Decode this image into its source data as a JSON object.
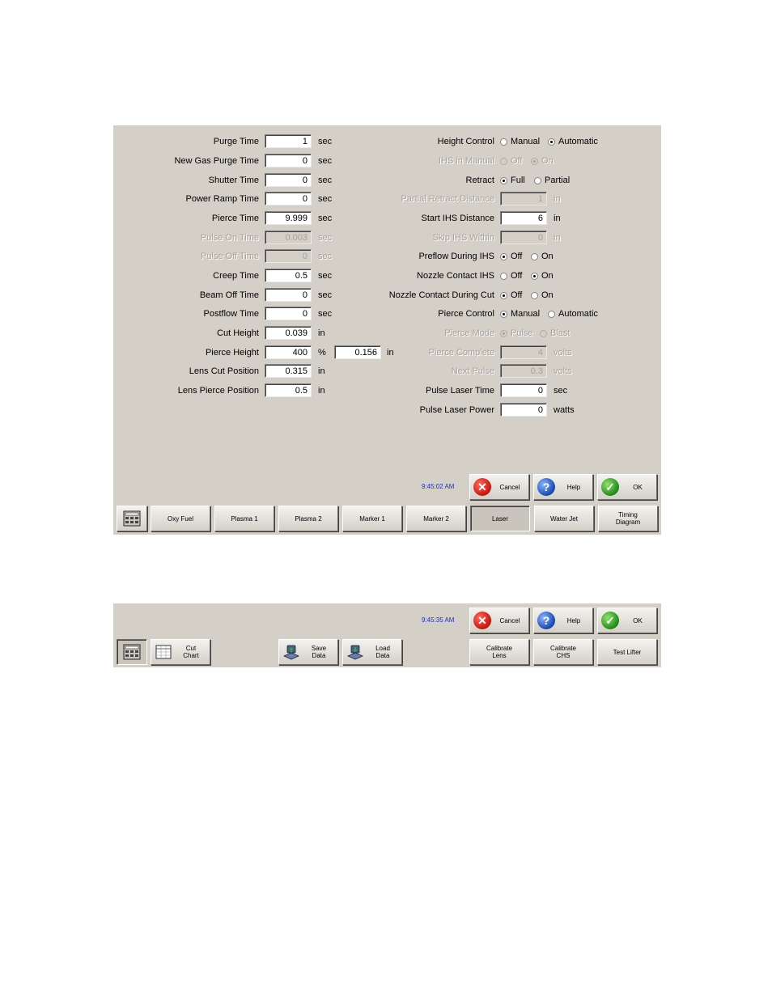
{
  "screen1": {
    "left_fields": [
      {
        "label": "Purge Time",
        "value": "1",
        "unit": "sec",
        "disabled": false
      },
      {
        "label": "New Gas Purge Time",
        "value": "0",
        "unit": "sec",
        "disabled": false
      },
      {
        "label": "Shutter Time",
        "value": "0",
        "unit": "sec",
        "disabled": false
      },
      {
        "label": "Power Ramp Time",
        "value": "0",
        "unit": "sec",
        "disabled": false
      },
      {
        "label": "Pierce Time",
        "value": "9.999",
        "unit": "sec",
        "disabled": false
      },
      {
        "label": "Pulse On Time",
        "value": "0.003",
        "unit": "sec",
        "disabled": true
      },
      {
        "label": "Pulse Off Time",
        "value": "0",
        "unit": "sec",
        "disabled": true
      },
      {
        "label": "Creep Time",
        "value": "0.5",
        "unit": "sec",
        "disabled": false
      },
      {
        "label": "Beam Off Time",
        "value": "0",
        "unit": "sec",
        "disabled": false
      },
      {
        "label": "Postflow Time",
        "value": "0",
        "unit": "sec",
        "disabled": false
      },
      {
        "label": "Cut Height",
        "value": "0.039",
        "unit": "in",
        "disabled": false
      },
      {
        "label": "Pierce Height",
        "value": "400",
        "unit": "%",
        "disabled": false
      },
      {
        "label": "Lens Cut Position",
        "value": "0.315",
        "unit": "in",
        "disabled": false
      },
      {
        "label": "Lens Pierce Position",
        "value": "0.5",
        "unit": "in",
        "disabled": false
      }
    ],
    "pierce_height_extra": {
      "value": "0.156",
      "unit": "in"
    },
    "right_rows": {
      "height_control": {
        "label": "Height Control",
        "opt1": "Manual",
        "opt2": "Automatic"
      },
      "ihs_in_manual": {
        "label": "IHS in Manual",
        "opt1": "Off",
        "opt2": "On"
      },
      "retract": {
        "label": "Retract",
        "opt1": "Full",
        "opt2": "Partial"
      },
      "partial_retract_distance": {
        "label": "Partial Retract Distance",
        "value": "1",
        "unit": "in"
      },
      "start_ihs_distance": {
        "label": "Start IHS Distance",
        "value": "6",
        "unit": "in"
      },
      "skip_ihs_within": {
        "label": "Skip IHS Within",
        "value": "0",
        "unit": "in"
      },
      "preflow_during_ihs": {
        "label": "Preflow During IHS",
        "opt1": "Off",
        "opt2": "On"
      },
      "nozzle_contact_ihs": {
        "label": "Nozzle Contact IHS",
        "opt1": "Off",
        "opt2": "On"
      },
      "nozzle_contact_during_cut": {
        "label": "Nozzle Contact During Cut",
        "opt1": "Off",
        "opt2": "On"
      },
      "pierce_control": {
        "label": "Pierce Control",
        "opt1": "Manual",
        "opt2": "Automatic"
      },
      "pierce_mode": {
        "label": "Pierce Mode",
        "opt1": "Pulse",
        "opt2": "Blast"
      },
      "pierce_complete": {
        "label": "Pierce Complete",
        "value": "4",
        "unit": "volts"
      },
      "next_pulse": {
        "label": "Next Pulse",
        "value": "0.3",
        "unit": "volts"
      },
      "pulse_laser_time": {
        "label": "Pulse Laser Time",
        "value": "0",
        "unit": "sec"
      },
      "pulse_laser_power": {
        "label": "Pulse Laser Power",
        "value": "0",
        "unit": "watts"
      }
    },
    "time": "9:45:02 AM",
    "action_buttons": {
      "cancel": "Cancel",
      "help": "Help",
      "ok": "OK"
    },
    "tabs": {
      "oxy_fuel": "Oxy Fuel",
      "plasma1": "Plasma 1",
      "plasma2": "Plasma 2",
      "marker1": "Marker 1",
      "marker2": "Marker 2",
      "laser": "Laser",
      "water_jet": "Water Jet",
      "timing_diagram": "Timing\nDiagram"
    }
  },
  "screen2": {
    "time": "9:45:35 AM",
    "action_buttons": {
      "cancel": "Cancel",
      "help": "Help",
      "ok": "OK"
    },
    "buttons": {
      "cut_chart": "Cut\nChart",
      "save_data": "Save\nData",
      "load_data": "Load\nData",
      "calibrate_lens": "Calibrate\nLens",
      "calibrate_chs": "Calibrate\nCHS",
      "test_lifter": "Test Lifter"
    }
  },
  "icons": {
    "cancel": "cancel-x-icon",
    "help": "help-question-icon",
    "ok": "ok-check-icon",
    "table": "cut-chart-table-icon",
    "keypad": "keypad-grid-icon",
    "save": "save-disk-icon",
    "load": "load-disk-icon"
  },
  "colors": {
    "panel": "#d4d0c8",
    "time": "#2030c0",
    "cancel": "#c8140c",
    "help": "#1846b0",
    "ok": "#1e8a18"
  }
}
